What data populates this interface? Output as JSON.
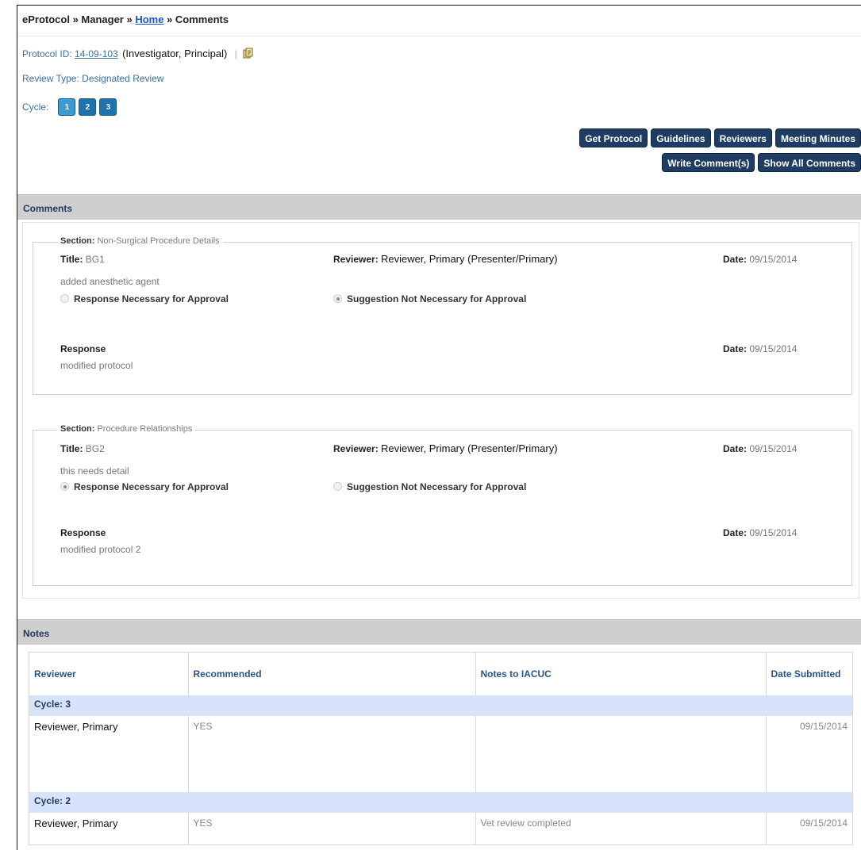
{
  "breadcrumb": {
    "part1": "eProtocol » Manager » ",
    "home": "Home",
    "part2": " » Comments"
  },
  "protocol": {
    "label": "Protocol ID: ",
    "id": "14-09-103",
    "role": "(Investigator, Principal)"
  },
  "review_type": "Review Type: Designated Review",
  "cycle": {
    "label": "Cycle:",
    "buttons": [
      "1",
      "2",
      "3"
    ]
  },
  "actions": {
    "get_protocol": "Get Protocol",
    "guidelines": "Guidelines",
    "reviewers": "Reviewers",
    "meeting_minutes": "Meeting Minutes",
    "write_comments": "Write Comment(s)",
    "show_all_comments": "Show All Comments"
  },
  "comments_header": "Comments",
  "comments": [
    {
      "section_label": "Section:",
      "section": "Non-Surgical Procedure Details",
      "title_label": "Title:",
      "title": "BG1",
      "reviewer_label": "Reviewer:",
      "reviewer": "Reviewer, Primary (Presenter/Primary)",
      "date_label": "Date:",
      "date": "09/15/2014",
      "text": "added anesthetic agent",
      "opt_necessary": "Response Necessary for Approval",
      "opt_not_necessary": "Suggestion Not Necessary for Approval",
      "selected": "not_necessary",
      "response_label": "Response",
      "response_text": "modified protocol",
      "response_date": "09/15/2014"
    },
    {
      "section_label": "Section:",
      "section": "Procedure Relationships",
      "title_label": "Title:",
      "title": "BG2",
      "reviewer_label": "Reviewer:",
      "reviewer": "Reviewer, Primary (Presenter/Primary)",
      "date_label": "Date:",
      "date": "09/15/2014",
      "text": "this needs detail",
      "opt_necessary": "Response Necessary for Approval",
      "opt_not_necessary": "Suggestion Not Necessary for Approval",
      "selected": "necessary",
      "response_label": "Response",
      "response_text": "modified protocol 2",
      "response_date": "09/15/2014"
    }
  ],
  "notes_header": "Notes",
  "notes_table": {
    "columns": [
      "Reviewer",
      "Recommended",
      "Notes to IACUC",
      "Date Submitted"
    ],
    "groups": [
      {
        "cycle": "Cycle: 3",
        "rows": [
          {
            "reviewer": "Reviewer, Primary",
            "recommended": "YES",
            "notes": "",
            "date": "09/15/2014"
          }
        ]
      },
      {
        "cycle": "Cycle: 2",
        "rows": [
          {
            "reviewer": "Reviewer, Primary",
            "recommended": "YES",
            "notes": "Vet review completed",
            "date": "09/15/2014"
          }
        ]
      }
    ]
  }
}
